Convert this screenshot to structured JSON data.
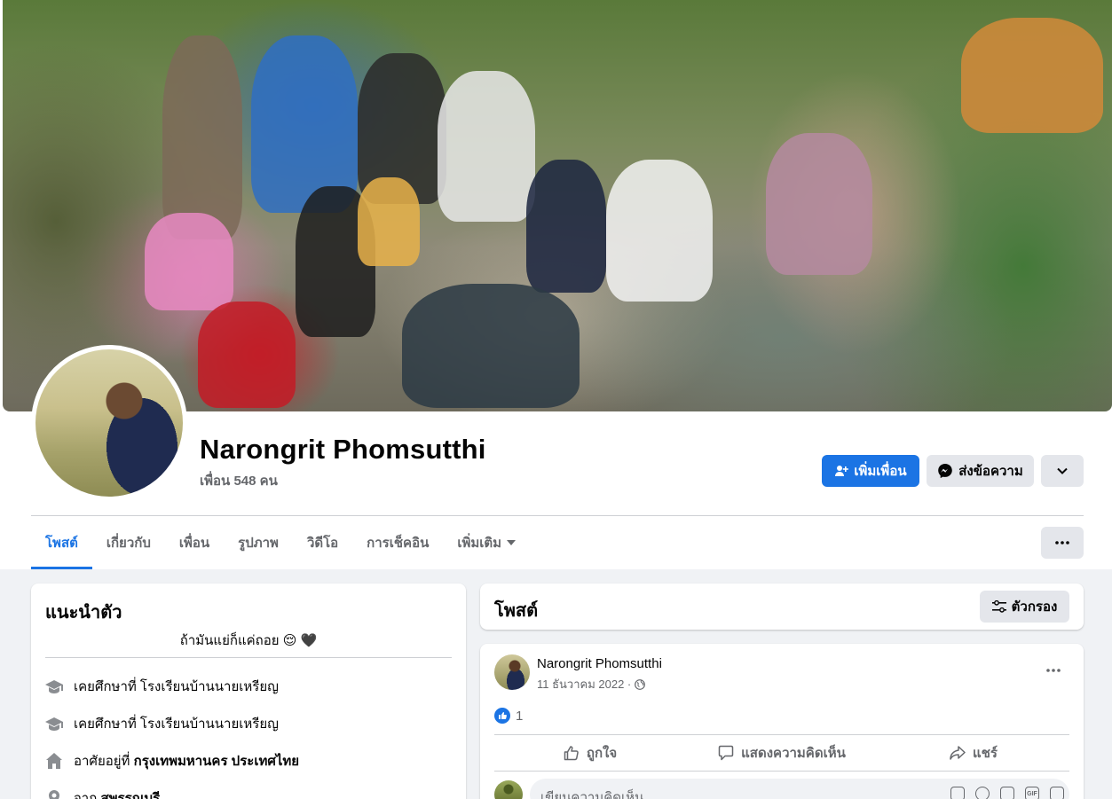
{
  "profile": {
    "name": "Narongrit Phomsutthi",
    "friends": "เพื่อน 548 คน"
  },
  "actions": {
    "add_friend": "เพิ่มเพื่อน",
    "message": "ส่งข้อความ"
  },
  "tabs": [
    {
      "label": "โพสต์",
      "active": true
    },
    {
      "label": "เกี่ยวกับ"
    },
    {
      "label": "เพื่อน"
    },
    {
      "label": "รูปภาพ"
    },
    {
      "label": "วิดีโอ"
    },
    {
      "label": "การเช็คอิน"
    },
    {
      "label": "เพิ่มเติม"
    }
  ],
  "intro": {
    "title": "แนะนำตัว",
    "bio": "ถ้ามันแย่ก็แค่ถอย 😌 🖤",
    "rows": [
      {
        "icon": "graduation-cap-icon",
        "text": "เคยศึกษาที่ โรงเรียนบ้านนายเหรียญ"
      },
      {
        "icon": "graduation-cap-icon",
        "text": "เคยศึกษาที่ โรงเรียนบ้านนายเหรียญ"
      },
      {
        "icon": "home-icon",
        "prefix": "อาศัยอยู่ที่ ",
        "bold": "กรุงเทพมหานคร ประเทศไทย"
      },
      {
        "icon": "location-pin-icon",
        "prefix": "จาก ",
        "bold": "สุพรรณบุรี"
      }
    ]
  },
  "posts": {
    "title": "โพสต์",
    "filter": "ตัวกรอง"
  },
  "post": {
    "author": "Narongrit Phomsutthi",
    "date": "11 ธันวาคม 2022 ·",
    "like_count": "1",
    "like": "ถูกใจ",
    "comment": "แสดงความคิดเห็น",
    "share": "แชร์",
    "comment_placeholder": "เขียนความคิดเห็น..."
  },
  "colors": {
    "accent": "#1b74e4",
    "background": "#f0f2f5",
    "secondary_text": "#65676b"
  }
}
